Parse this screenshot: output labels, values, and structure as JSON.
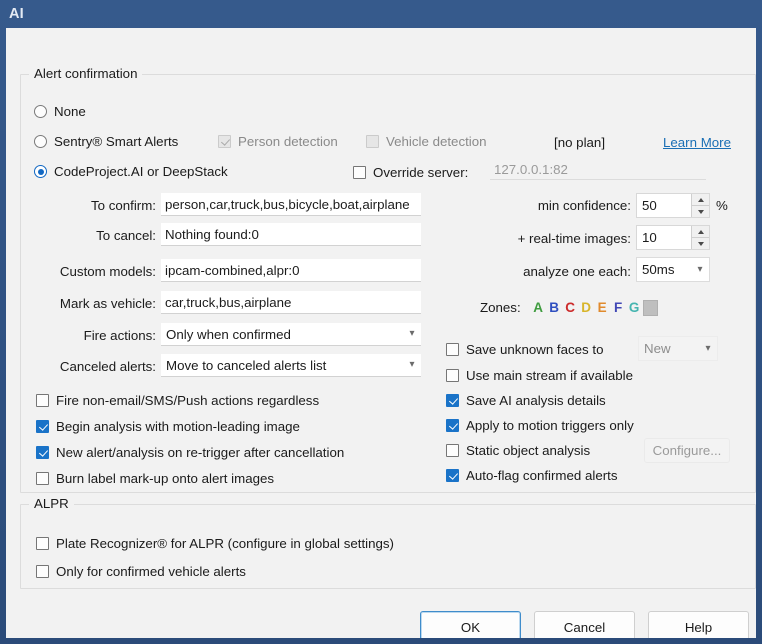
{
  "window": {
    "title": "AI"
  },
  "alert_group": {
    "legend": "Alert confirmation",
    "modes": [
      {
        "label": "None",
        "checked": false
      },
      {
        "label": "Sentry® Smart Alerts",
        "checked": false
      },
      {
        "label": "CodeProject.AI or DeepStack",
        "checked": true
      }
    ],
    "sentry_options": [
      {
        "label": "Person detection",
        "checked": true,
        "disabled": true
      },
      {
        "label": "Vehicle detection",
        "checked": false,
        "disabled": true
      }
    ],
    "plan_status": "[no plan]",
    "learn_more": "Learn More",
    "override_server": {
      "label": "Override server:",
      "checked": false,
      "value": "127.0.0.1:82"
    },
    "fields": [
      {
        "label": "To confirm:",
        "value": "person,car,truck,bus,bicycle,boat,airplane"
      },
      {
        "label": "To cancel:",
        "value": "Nothing found:0"
      },
      {
        "label": "Custom models:",
        "value": "ipcam-combined,alpr:0"
      },
      {
        "label": "Mark as vehicle:",
        "value": "car,truck,bus,airplane"
      }
    ],
    "selects": [
      {
        "label": "Fire actions:",
        "value": "Only when confirmed"
      },
      {
        "label": "Canceled alerts:",
        "value": "Move to canceled alerts list"
      }
    ],
    "numeric": [
      {
        "label": "min confidence:",
        "value": "50",
        "suffix": "%"
      },
      {
        "label": "+ real-time images:",
        "value": "10",
        "suffix": ""
      }
    ],
    "analyze_each": {
      "label": "analyze one each:",
      "value": "50ms"
    },
    "zones": {
      "label": "Zones:",
      "items": [
        {
          "letter": "A",
          "color": "#3f9c3f"
        },
        {
          "letter": "B",
          "color": "#2f4fc0"
        },
        {
          "letter": "C",
          "color": "#cc2b2b"
        },
        {
          "letter": "D",
          "color": "#d8b52a"
        },
        {
          "letter": "E",
          "color": "#e08a2c"
        },
        {
          "letter": "F",
          "color": "#4047b5"
        },
        {
          "letter": "G",
          "color": "#46b5b0"
        }
      ],
      "empty_slot": true
    },
    "left_checkboxes": [
      {
        "label": "Fire non-email/SMS/Push actions regardless",
        "checked": false
      },
      {
        "label": "Begin analysis with motion-leading image",
        "checked": true
      },
      {
        "label": "New alert/analysis on re-trigger after cancellation",
        "checked": true
      },
      {
        "label": "Burn label mark-up onto alert images",
        "checked": false
      }
    ],
    "right_checkboxes": [
      {
        "label": "Save unknown faces to",
        "checked": false
      },
      {
        "label": "Use main stream if available",
        "checked": false
      },
      {
        "label": "Save AI analysis details",
        "checked": true
      },
      {
        "label": "Apply to motion triggers only",
        "checked": true
      },
      {
        "label": "Static object analysis",
        "checked": false
      },
      {
        "label": "Auto-flag confirmed alerts",
        "checked": true
      }
    ],
    "faces_folder": {
      "value": "New"
    },
    "configure_button": {
      "label": "Configure..."
    }
  },
  "alpr_group": {
    "legend": "ALPR",
    "checkboxes": [
      {
        "label": "Plate Recognizer® for ALPR (configure in global settings)",
        "checked": false
      },
      {
        "label": "Only for confirmed vehicle alerts",
        "checked": false
      }
    ]
  },
  "footer": {
    "ok": "OK",
    "cancel": "Cancel",
    "help": "Help"
  },
  "colors": {
    "titlebar": "#2f5182",
    "accent": "#1268c3",
    "checkbox_fill": "#1a73c8",
    "link": "#1a6fb5",
    "panel": "#f2f2f2"
  }
}
